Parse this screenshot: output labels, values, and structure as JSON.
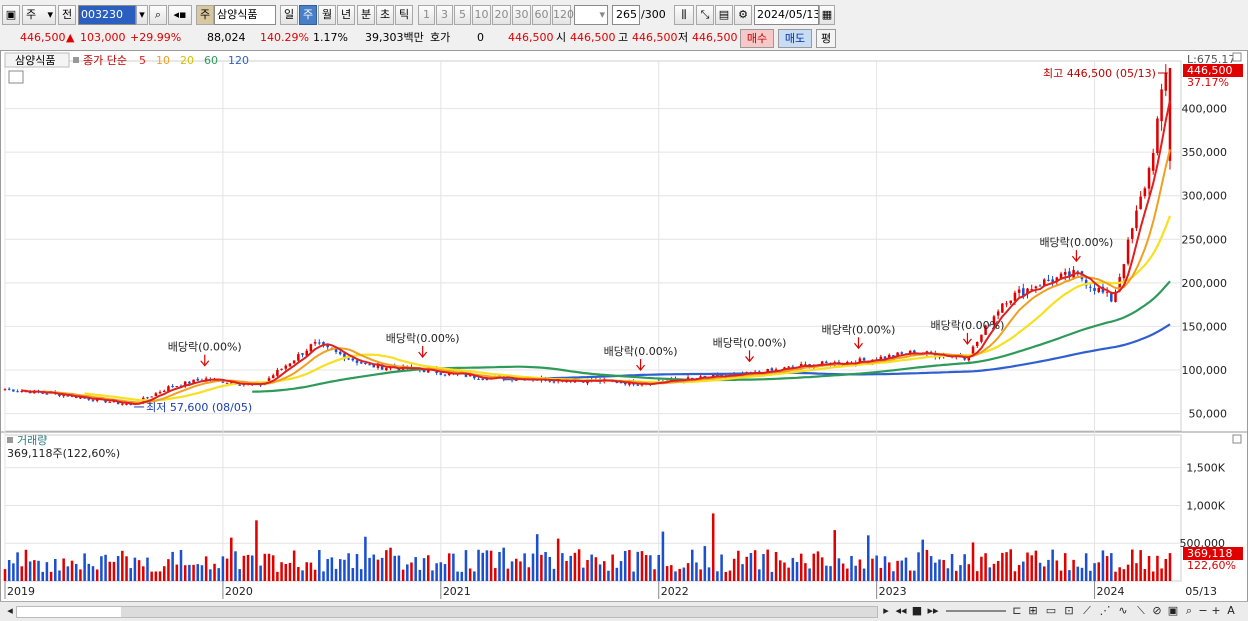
{
  "toolbar": {
    "type_select": "주",
    "market_select": "전",
    "stock_code": "003230",
    "stock_tag": "주",
    "stock_name": "삼양식품",
    "periods": [
      "일",
      "주",
      "월",
      "년",
      "분",
      "초",
      "틱"
    ],
    "active_period": "주",
    "intervals": [
      "1",
      "3",
      "5",
      "10",
      "20",
      "30",
      "60",
      "120"
    ],
    "count_value": "265",
    "count_total": "/300",
    "date_value": "2024/05/13"
  },
  "quote": {
    "price": "446,500",
    "change": "103,000",
    "change_pct": "+29.99%",
    "volume": "88,024",
    "volume_ratio": "140.29%",
    "turnover": "1.17%",
    "amount": "39,303백만",
    "hoga_label": "호가",
    "hoga_value": "0",
    "bid": "446,500",
    "open_label": "시",
    "open": "446,500",
    "high_label": "고",
    "high": "446,500",
    "low_label": "저",
    "low": "446,500",
    "buy_label": "매수",
    "sell_label": "매도",
    "avg_label": "평"
  },
  "colors": {
    "up": "#e00000",
    "down": "#1a4fd0",
    "ma5": "#e02020",
    "ma10": "#f0a020",
    "ma20": "#f6e020",
    "ma60": "#2e9a5a",
    "ma120": "#2f5fd0"
  },
  "chart_data": {
    "type": "candlestick",
    "stock": "삼양식품",
    "legend": {
      "title": "종가 단순",
      "periods": [
        "5",
        "10",
        "20",
        "60",
        "120"
      ]
    },
    "price_axis": {
      "ticks": [
        50000,
        100000,
        150000,
        200000,
        250000,
        300000,
        350000,
        400000
      ],
      "tick_labels": [
        "50,000",
        "100,000",
        "150,000",
        "200,000",
        "250,000",
        "300,000",
        "350,000",
        "400,000"
      ],
      "range": [
        30000,
        450000
      ],
      "corner_label": "L:675.17",
      "current_label": "446,500",
      "current_pct": "37.17%"
    },
    "x_axis": {
      "labels": [
        "2019",
        "2020",
        "2021",
        "2022",
        "2023",
        "2024"
      ],
      "label_dates": [
        "2019-01",
        "2020-01",
        "2021-01",
        "2022-01",
        "2023-01",
        "2024-01"
      ],
      "end_label": "05/13"
    },
    "annotations": {
      "high": "최고 446,500 (05/13)",
      "low": "최저 57,600 (08/05)",
      "dividend": "배당락(0.00%)",
      "dividend_dates": [
        "2019-12",
        "2020-12",
        "2021-12",
        "2022-06",
        "2022-12",
        "2023-06",
        "2023-12"
      ]
    },
    "close_series": [
      {
        "date": "2019-01",
        "close": 78000
      },
      {
        "date": "2019-04",
        "close": 72000
      },
      {
        "date": "2019-08",
        "close": 60000
      },
      {
        "date": "2019-10",
        "close": 80000
      },
      {
        "date": "2019-12",
        "close": 90000
      },
      {
        "date": "2020-03",
        "close": 82000
      },
      {
        "date": "2020-06",
        "close": 130000
      },
      {
        "date": "2020-09",
        "close": 105000
      },
      {
        "date": "2020-12",
        "close": 100000
      },
      {
        "date": "2021-03",
        "close": 92000
      },
      {
        "date": "2021-06",
        "close": 90000
      },
      {
        "date": "2021-09",
        "close": 88000
      },
      {
        "date": "2021-12",
        "close": 85000
      },
      {
        "date": "2022-03",
        "close": 90000
      },
      {
        "date": "2022-06",
        "close": 95000
      },
      {
        "date": "2022-09",
        "close": 105000
      },
      {
        "date": "2022-12",
        "close": 110000
      },
      {
        "date": "2023-03",
        "close": 120000
      },
      {
        "date": "2023-06",
        "close": 115000
      },
      {
        "date": "2023-08",
        "close": 180000
      },
      {
        "date": "2023-10",
        "close": 200000
      },
      {
        "date": "2023-12",
        "close": 210000
      },
      {
        "date": "2024-02",
        "close": 180000
      },
      {
        "date": "2024-04",
        "close": 330000
      },
      {
        "date": "2024-05",
        "close": 446500
      }
    ],
    "volume_panel": {
      "title": "거래량",
      "subtitle": "369,118주(122,60%)",
      "ticks": [
        500000,
        1000000,
        1500000
      ],
      "tick_labels": [
        "500,000",
        "1,000K",
        "1,500K"
      ],
      "range": [
        0,
        1800000
      ],
      "current_label": "369,118",
      "current_pct": "122,60%"
    }
  }
}
